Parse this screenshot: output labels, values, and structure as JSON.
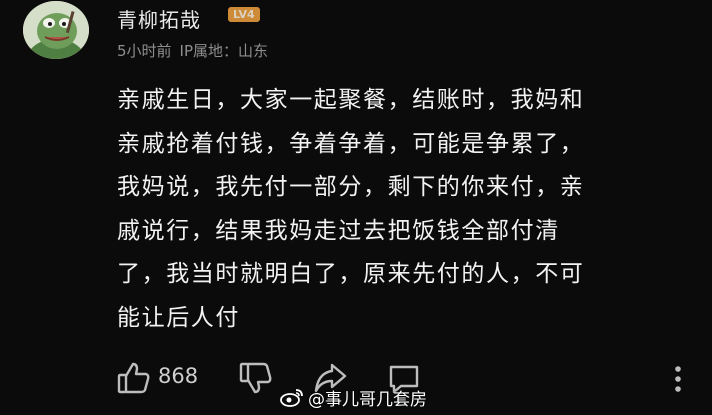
{
  "user": {
    "name": "青柳拓哉",
    "level": "LV4",
    "time": "5小时前",
    "location_label": "IP属地：山东"
  },
  "comment": {
    "lines": [
      "亲戚生日，大家一起聚餐，结账时，我妈和",
      "亲戚抢着付钱，争着争着，可能是争累了，",
      "我妈说，我先付一部分，剩下的你来付，亲",
      "戚说行，结果我妈走过去把饭钱全部付清",
      "了，我当时就明白了，原来先付的人，不可",
      "能让后人付"
    ]
  },
  "actions": {
    "like_count": "868"
  },
  "watermark": {
    "text": "@事儿哥几套房"
  }
}
